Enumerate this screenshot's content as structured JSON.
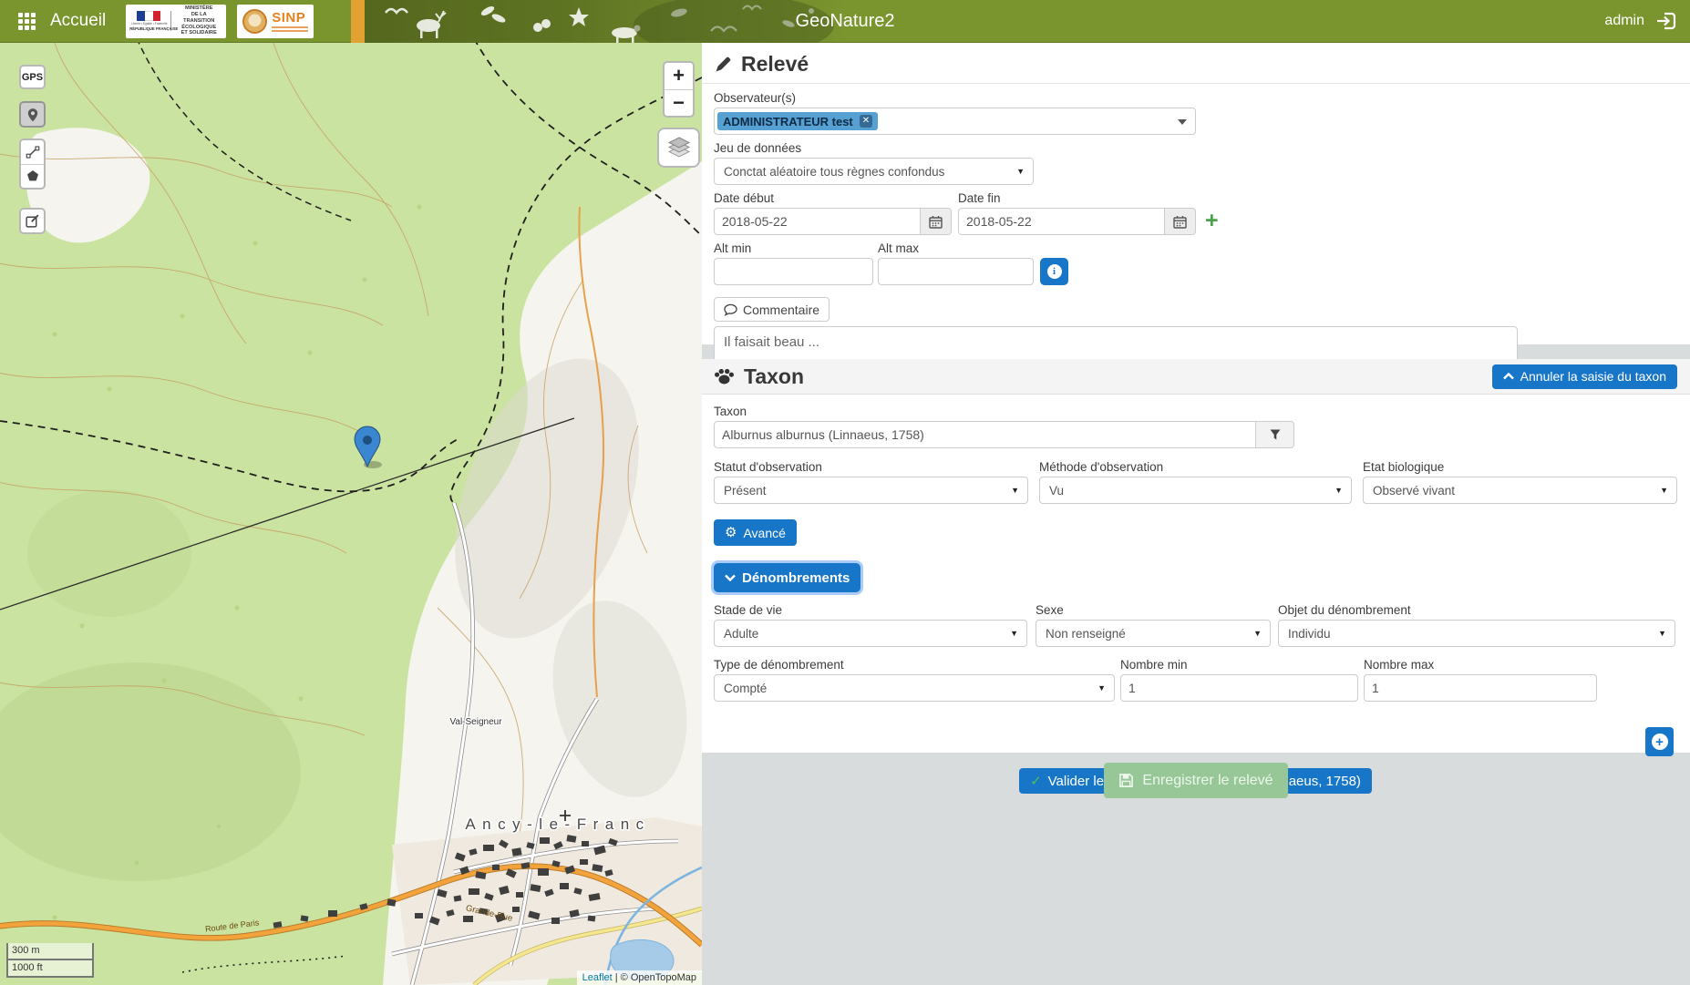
{
  "colors": {
    "navbar_green": "#7a942e",
    "primary_blue": "#1876c8",
    "chip_blue": "#57a0d2",
    "success_green": "#4aa14a",
    "save_disabled_green": "#97c797"
  },
  "navbar": {
    "home_label": "Accueil",
    "app_title": "GeoNature2",
    "username": "admin",
    "ministry_logo": {
      "flag_motto": "Liberté • Égalité • Fraternité",
      "flag_country": "RÉPUBLIQUE FRANÇAISE",
      "lines": [
        "MINISTÈRE",
        "DE LA TRANSITION",
        "ÉCOLOGIQUE",
        "ET SOLIDAIRE"
      ]
    },
    "sinp_logo": {
      "label": "SINP"
    }
  },
  "map": {
    "controls": {
      "gps": "GPS",
      "zoom_in": "+",
      "zoom_out": "−"
    },
    "scale": {
      "metric": "300 m",
      "imperial": "1000 ft"
    },
    "attribution": {
      "leaflet": "Leaflet",
      "separator": "|",
      "provider": "© OpenTopoMap"
    },
    "labels": {
      "town": "Ancy-le-Franc",
      "street": "Grande-Rue",
      "road": "Route de Paris",
      "hamlet": "Val-Seigneur"
    }
  },
  "releve": {
    "title": "Relevé",
    "observers_label": "Observateur(s)",
    "observer_chip": "ADMINISTRATEUR test",
    "dataset_label": "Jeu de données",
    "dataset_value": "Conctat aléatoire tous règnes confondus",
    "date_start_label": "Date début",
    "date_start": "2018-05-22",
    "date_end_label": "Date fin",
    "date_end": "2018-05-22",
    "alt_min_label": "Alt min",
    "alt_max_label": "Alt max",
    "comment_button": "Commentaire",
    "comment_value": "Il faisait beau ..."
  },
  "taxon": {
    "title": "Taxon",
    "cancel_button": "Annuler la saisie du taxon",
    "taxon_label": "Taxon",
    "taxon_value": "Alburnus alburnus (Linnaeus, 1758)",
    "statut_label": "Statut d'observation",
    "statut_value": "Présent",
    "methode_label": "Méthode d'observation",
    "methode_value": "Vu",
    "etat_label": "Etat biologique",
    "etat_value": "Observé vivant",
    "advanced_button": "Avancé",
    "counting": {
      "title": "Dénombrements",
      "stade_label": "Stade de vie",
      "stade_value": "Adulte",
      "sexe_label": "Sexe",
      "sexe_value": "Non renseigné",
      "objet_label": "Objet du dénombrement",
      "objet_value": "Individu",
      "type_label": "Type de dénombrement",
      "type_value": "Compté",
      "min_label": "Nombre min",
      "min_value": "1",
      "max_label": "Nombre max",
      "max_value": "1"
    },
    "validate_button": "Valider le taxon Alburnus alburnus (Linnaeus, 1758)"
  },
  "footer": {
    "save_button": "Enregistrer le relevé"
  },
  "icons": {
    "close": "✕",
    "add": "+",
    "check": "✓",
    "gear": "⚙",
    "info": "i"
  }
}
